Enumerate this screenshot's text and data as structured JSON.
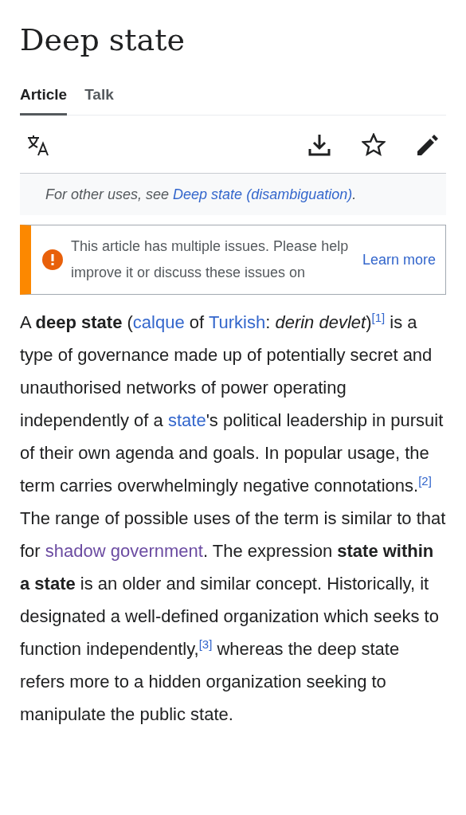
{
  "title": "Deep state",
  "tabs": [
    {
      "label": "Article",
      "selected": true
    },
    {
      "label": "Talk",
      "selected": false
    }
  ],
  "hatnote": {
    "prefix": "For other uses, see ",
    "link": "Deep state (disambiguation)",
    "suffix": "."
  },
  "issue_box": {
    "text": "This article has multiple issues. Please help improve it or discuss these issues on",
    "action": "Learn more"
  },
  "paragraph": [
    {
      "kind": "text",
      "text": "A **deep state** ("
    },
    {
      "kind": "link",
      "text": "calque",
      "visited": false
    },
    {
      "kind": "text",
      "text": " of "
    },
    {
      "kind": "link",
      "text": "Turkish",
      "visited": false
    },
    {
      "kind": "text",
      "text": ": *derin devlet*)"
    },
    {
      "kind": "ref",
      "text": "[1]"
    },
    {
      "kind": "text",
      "text": " is a type of governance made up of potentially secret and unauthorised networks of power operating independently of a "
    },
    {
      "kind": "link",
      "text": "state",
      "visited": false
    },
    {
      "kind": "text",
      "text": "'s political leadership in pursuit of their own agenda and goals. In popular usage, the term carries overwhelmingly negative connotations."
    },
    {
      "kind": "ref",
      "text": "[2]"
    },
    {
      "kind": "text",
      "text": " The range of possible uses of the term is similar to that for "
    },
    {
      "kind": "link",
      "text": "shadow government",
      "visited": true
    },
    {
      "kind": "text",
      "text": ". The expression **state within a state** is an older and similar concept. Historically, it designated a well-defined organization which seeks to function independently,"
    },
    {
      "kind": "ref",
      "text": "[3]"
    },
    {
      "kind": "text",
      "text": " whereas the deep state refers more to a hidden organization seeking to manipulate the public state."
    }
  ]
}
